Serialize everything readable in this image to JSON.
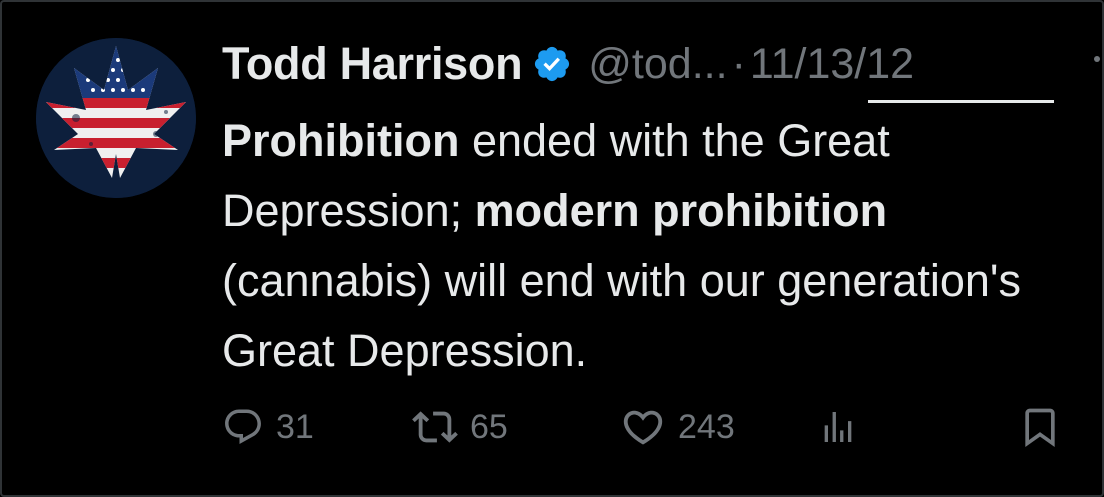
{
  "tweet": {
    "author_name": "Todd Harrison",
    "handle": "@tod...",
    "separator": "·",
    "date": "11/13/12",
    "text": {
      "p1_bold": "Prohibition",
      "p2": " ended with the Great Depression; ",
      "p3_bold": "modern prohibition",
      "p4": " (cannabis) will end with our generation's Great Depression."
    }
  },
  "actions": {
    "replies": "31",
    "reposts": "65",
    "likes": "243"
  },
  "colors": {
    "background": "#000000",
    "text": "#e7e9ea",
    "secondary": "#71767b",
    "verified": "#1d9bf0"
  },
  "icons": [
    "avatar-flag-leaf",
    "verified-badge-icon",
    "reply-icon",
    "repost-icon",
    "like-icon",
    "views-icon",
    "bookmark-icon"
  ]
}
